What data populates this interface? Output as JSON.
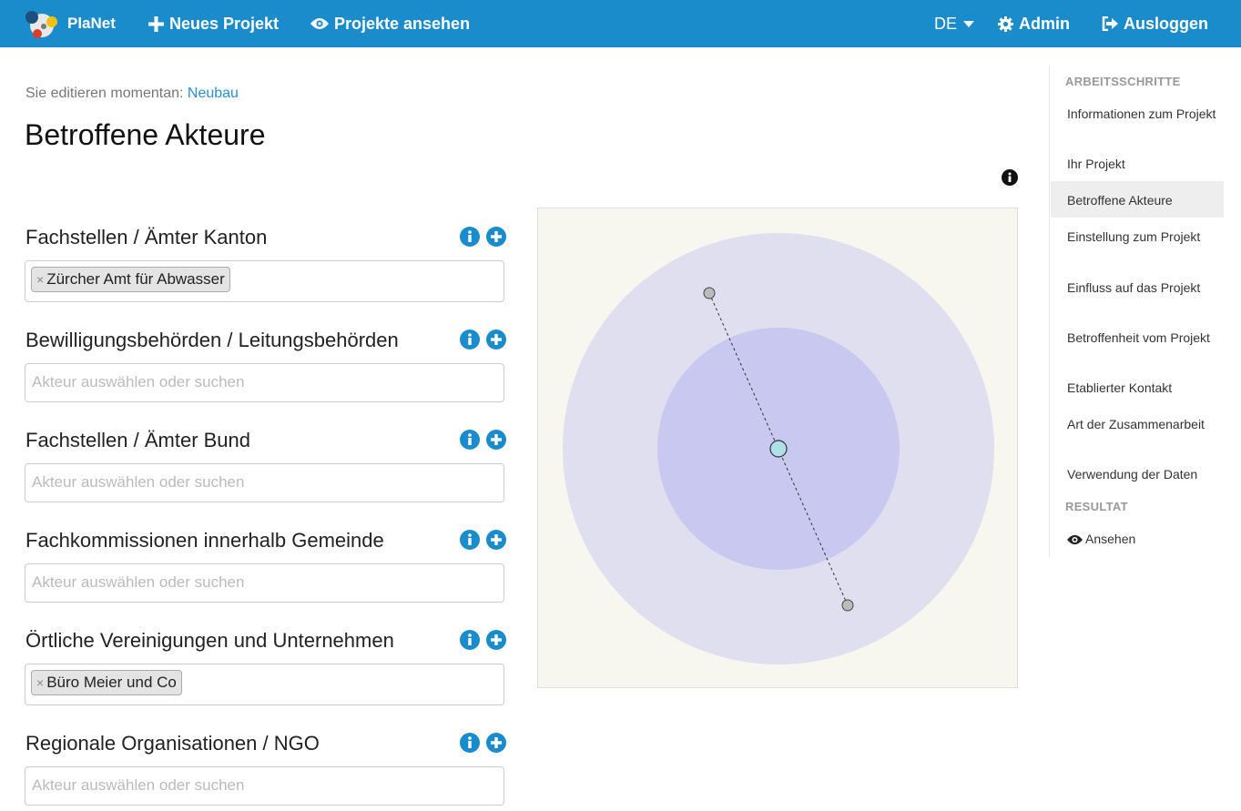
{
  "navbar": {
    "brand": "PlaNet",
    "new_project": "Neues Projekt",
    "view_projects": "Projekte ansehen",
    "language": "DE",
    "admin": "Admin",
    "logout": "Ausloggen"
  },
  "context": {
    "prefix": "Sie editieren momentan:",
    "project_name": "Neubau"
  },
  "page_title": "Betroffene Akteure",
  "groups": [
    {
      "label": "Fachstellen / Ämter Kanton",
      "tags": [
        "Zürcher Amt für Abwasser"
      ],
      "placeholder": ""
    },
    {
      "label": "Bewilligungsbehörden / Leitungsbehörden",
      "tags": [],
      "placeholder": "Akteur auswählen oder suchen"
    },
    {
      "label": "Fachstellen / Ämter Bund",
      "tags": [],
      "placeholder": "Akteur auswählen oder suchen"
    },
    {
      "label": "Fachkommissionen innerhalb Gemeinde",
      "tags": [],
      "placeholder": "Akteur auswählen oder suchen"
    },
    {
      "label": "Örtliche Vereinigungen und Unternehmen",
      "tags": [
        "Büro Meier und Co"
      ],
      "placeholder": ""
    },
    {
      "label": "Regionale Organisationen / NGO",
      "tags": [],
      "placeholder": "Akteur auswählen oder suchen"
    }
  ],
  "tag_remove_symbol": "×",
  "sidebar": {
    "steps_heading": "ARBEITSSCHRITTE",
    "steps": [
      "Informationen zum Projekt",
      "Ihr Projekt",
      "Betroffene Akteure",
      "Einstellung zum Projekt",
      "Einfluss auf das Projekt",
      "Betroffenheit vom Projekt",
      "Etablierter Kontakt",
      "Art der Zusammenarbeit",
      "Verwendung der Daten"
    ],
    "active_step": "Betroffene Akteure",
    "result_heading": "RESULTAT",
    "view_label": "Ansehen"
  },
  "colors": {
    "navbar": "#1b8ccb",
    "info_button": "#1b8ccb",
    "outer_circle": "#dfdff0",
    "inner_circle": "#c8c8f0",
    "center_node": "#aee0e8",
    "actor_node": "#bbbbbb",
    "chart_background": "#f7f6ef"
  },
  "icons": {
    "new_project": "plus-icon",
    "view_projects": "eye-icon",
    "language": "caret-down-icon",
    "admin": "gear-icon",
    "logout": "sign-out-icon",
    "group_info": "info-circle-icon",
    "group_add": "plus-circle-icon",
    "chart_info": "info-circle-icon",
    "sidebar_view": "eye-icon"
  }
}
